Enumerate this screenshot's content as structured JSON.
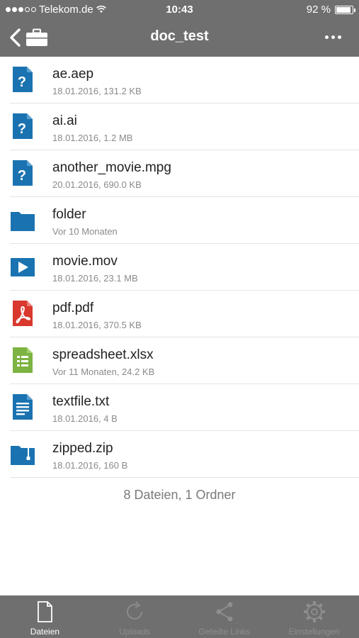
{
  "status_bar": {
    "carrier": "Telekom.de",
    "time": "10:43",
    "battery_text": "92 %",
    "battery_level": 0.92,
    "signal_bars_filled": 3,
    "signal_bars_total": 5
  },
  "nav": {
    "title": "doc_test",
    "back_icon": "chevron-left-icon",
    "back_context_icon": "briefcase-icon",
    "more_icon": "ellipsis-icon"
  },
  "colors": {
    "bar_bg": "#6f6f6f",
    "icon_blue": "#1a73b0",
    "icon_red": "#d8382d",
    "icon_green": "#7cb342"
  },
  "files": [
    {
      "name": "ae.aep",
      "meta": "18.01.2016, 131.2 KB",
      "icon": "unknown-file-icon"
    },
    {
      "name": "ai.ai",
      "meta": "18.01.2016, 1.2 MB",
      "icon": "unknown-file-icon"
    },
    {
      "name": "another_movie.mpg",
      "meta": "20.01.2016, 690.0 KB",
      "icon": "unknown-file-icon"
    },
    {
      "name": "folder",
      "meta": "Vor 10 Monaten",
      "icon": "folder-icon"
    },
    {
      "name": "movie.mov",
      "meta": "18.01.2016, 23.1 MB",
      "icon": "video-file-icon"
    },
    {
      "name": "pdf.pdf",
      "meta": "18.01.2016, 370.5 KB",
      "icon": "pdf-file-icon"
    },
    {
      "name": "spreadsheet.xlsx",
      "meta": "Vor 11 Monaten, 24.2 KB",
      "icon": "spreadsheet-file-icon"
    },
    {
      "name": "textfile.txt",
      "meta": "18.01.2016, 4 B",
      "icon": "text-file-icon"
    },
    {
      "name": "zipped.zip",
      "meta": "18.01.2016, 160 B",
      "icon": "zip-folder-icon"
    }
  ],
  "summary": "8 Dateien, 1 Ordner",
  "tabs": [
    {
      "label": "Dateien",
      "icon": "document-icon",
      "active": true
    },
    {
      "label": "Uploads",
      "icon": "refresh-icon",
      "active": false
    },
    {
      "label": "Geteilte Links",
      "icon": "share-icon",
      "active": false
    },
    {
      "label": "Einstellungen",
      "icon": "gear-icon",
      "active": false
    }
  ]
}
